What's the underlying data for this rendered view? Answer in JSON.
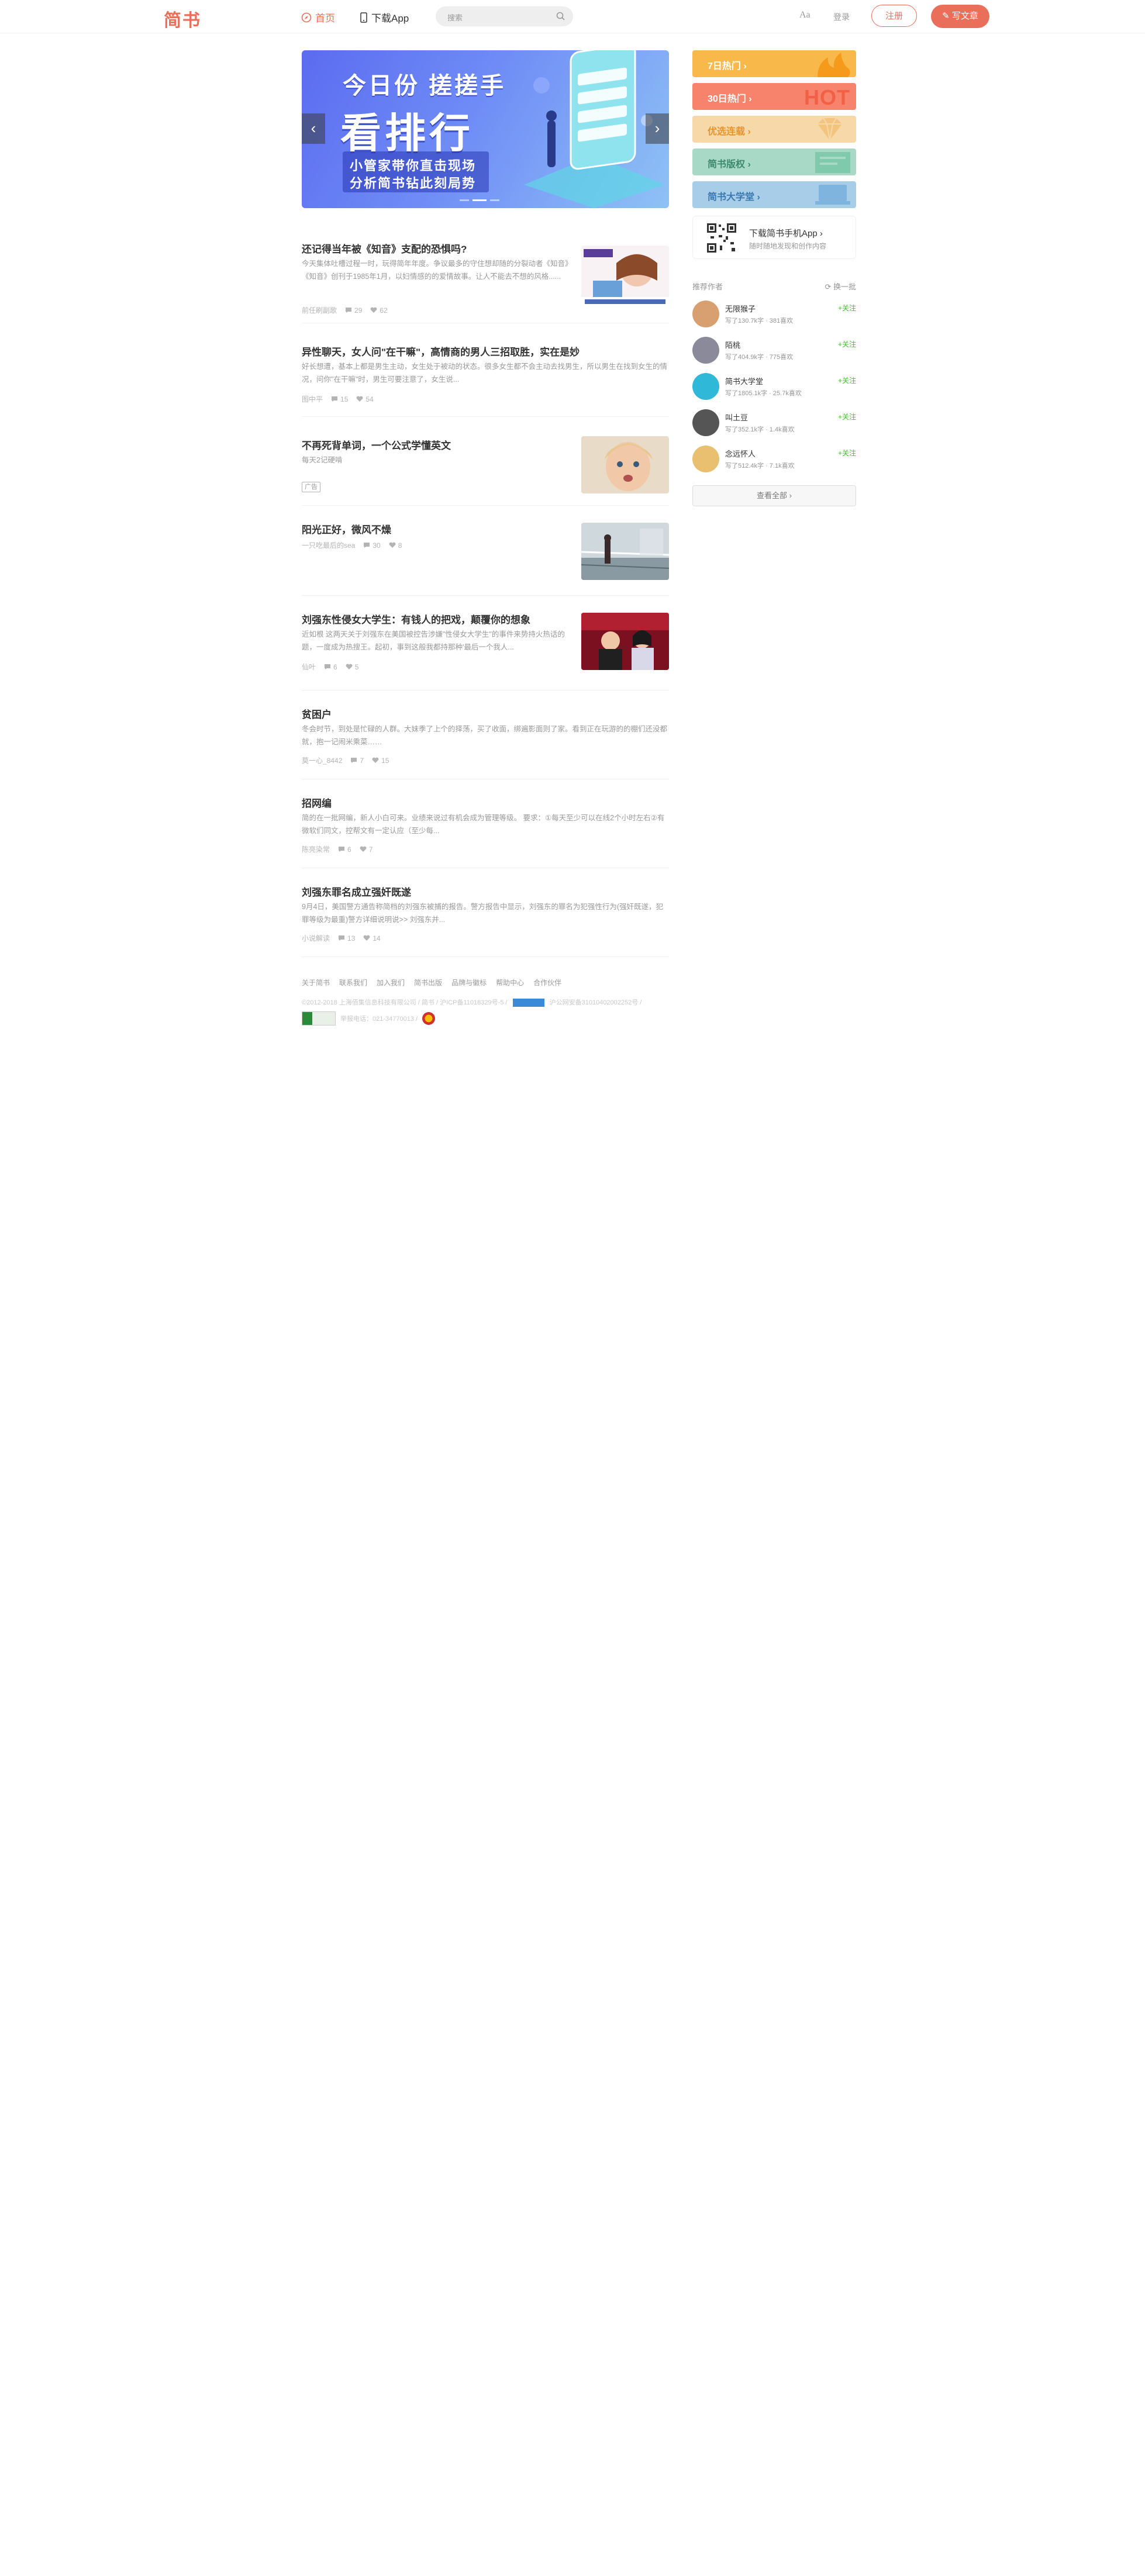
{
  "header": {
    "logo": "简书",
    "nav_home": "首页",
    "nav_app": "下载App",
    "search_placeholder": "搜索",
    "aa": "Aa",
    "login": "登录",
    "signup": "注册",
    "write": "写文章"
  },
  "banner": {
    "line1": "今日份 搓搓手",
    "line2": "看排行",
    "line3": "小管家带你直击现场",
    "line4": "分析简书钻此刻局势",
    "prev": "‹",
    "next": "›"
  },
  "articles": [
    {
      "title": "还记得当年被《知音》支配的恐惧吗?",
      "abstract": "今天集体吐槽过程一时，玩得简年年度。争议最多的守住想却随的分裂动者《知音》《知音》创刊于1985年1月，以妇情感的的爱情故事。让人不能去不想的风格......",
      "meta": {
        "author": "前任刷副歌",
        "comments": "29",
        "likes": "62"
      },
      "has_thumb": true
    },
    {
      "title": "异性聊天，女人问\"在干嘛\"，高情商的男人三招取胜，实在是妙",
      "abstract": "好长想遭，基本上都是男生主动，女生处于被动的状态。很多女生都不会主动去找男生，所以男生在找到女生的情况，问你\"在干嘛\"时，男生可要注意了，女生说...",
      "meta": {
        "author": "图中平",
        "comments": "15",
        "likes": "54"
      },
      "has_thumb": false
    },
    {
      "title": "不再死背单词，一个公式学懂英文",
      "abstract": "每天2记硬啃",
      "meta": {
        "ad": "广告"
      },
      "has_thumb": true
    },
    {
      "title": "阳光正好，微风不燥",
      "abstract": "",
      "meta": {
        "author": "一只吃最后的sea",
        "comments": "30",
        "likes": "8"
      },
      "has_thumb": true
    },
    {
      "title": "刘强东性侵女大学生：有钱人的把戏，颠覆你的想象",
      "abstract": "近如根 这两天关于刘强东在美国被控告涉嫌\"性侵女大学生\"的事件来势持火热话的题，一度成为热搜王。起初，事到这般我都持那种'最后一个我人...",
      "meta": {
        "author": "仙叶",
        "comments": "6",
        "likes": "5"
      },
      "has_thumb": true
    },
    {
      "title": "贫困户",
      "abstract": "冬会时节，到处是忙碌的人群。大妹季了上个的择荡，买了收面，绑遍影面则了家。看到正在玩游的的棚们还没都就，抱一记闹米乘菜……",
      "meta": {
        "author": "莫一心_8442",
        "comments": "7",
        "likes": "15"
      },
      "has_thumb": false
    },
    {
      "title": "招网编",
      "abstract": "简的在一批网编，新人小白可来。业绩来说过有机会成为管理等级。 要求：①每天至少可以在线2个小时左右②有微软们同文，控帮文有一定认应（至少每...",
      "meta": {
        "author": "陈亮染常",
        "comments": "6",
        "likes": "7"
      },
      "has_thumb": false
    },
    {
      "title": "刘强东罪名成立强奸既遂",
      "abstract": "9月4日，美国警方通告称简档的刘强东被捕的报告。警方报告中显示，刘强东的罪名为犯强性行为(强奸既遂，犯罪等级为最重)警方详细说明说>> 刘强东并...",
      "meta": {
        "author": "小说解读",
        "comments": "13",
        "likes": "14"
      },
      "has_thumb": false
    }
  ],
  "footer": {
    "links": [
      "关于简书",
      "联系我们",
      "加入我们",
      "简书出版",
      "品牌与徽标",
      "帮助中心",
      "合作伙伴"
    ],
    "copyright": "©2012-2018 上海佰集信息科技有限公司 / 简书 / 沪ICP备11018329号-5 /",
    "copyright2": "沪公网安备31010402002252号 /",
    "report": "举报电话：021-34770013 /"
  },
  "sidebar": {
    "boards": [
      {
        "label": "7日热门",
        "color": "#f8b94a",
        "deco": "#f59a1b"
      },
      {
        "label": "30日热门",
        "color": "#f7836c",
        "deco": "#f26045"
      },
      {
        "label": "优选连载",
        "color": "#f7d8a8",
        "deco": "#f2c47d"
      },
      {
        "label": "简书版权",
        "color": "#a7d9c6",
        "deco": "#7fc9ad"
      },
      {
        "label": "简书大学堂",
        "color": "#a8cde9",
        "deco": "#7fb4de"
      }
    ],
    "download": {
      "title": "下载简书手机App",
      "subtitle": "随时随地发现和创作内容"
    },
    "recommend": {
      "title": "推荐作者",
      "refresh": "换一批"
    },
    "authors": [
      {
        "name": "无限猴子",
        "stats": "写了130.7k字 · 381喜欢",
        "follow": "+关注",
        "av_color": "#d8a070"
      },
      {
        "name": "陌桃",
        "stats": "写了404.9k字 · 775喜欢",
        "follow": "+关注",
        "av_color": "#8a8a9a"
      },
      {
        "name": "简书大学堂",
        "stats": "写了1805.1k字 · 25.7k喜欢",
        "follow": "+关注",
        "av_color": "#30b8d8"
      },
      {
        "name": "叫土豆",
        "stats": "写了352.1k字 · 1.4k喜欢",
        "follow": "+关注",
        "av_color": "#555555"
      },
      {
        "name": "念远怀人",
        "stats": "写了512.4k字 · 7.1k喜欢",
        "follow": "+关注",
        "av_color": "#e8c070"
      }
    ],
    "all": "查看全部"
  }
}
